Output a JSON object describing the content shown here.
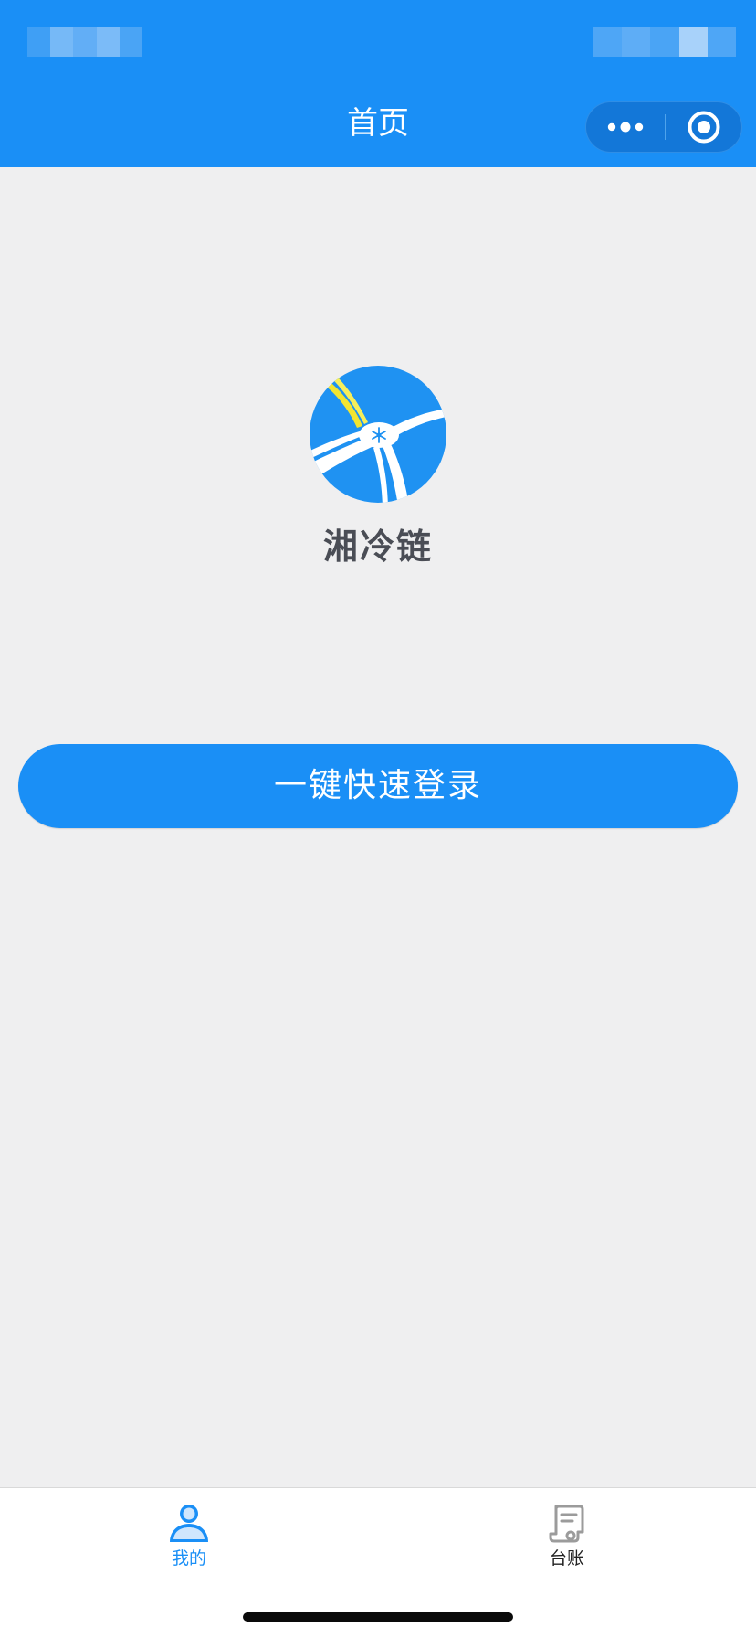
{
  "header": {
    "title": "首页",
    "background_color": "#1a8ff6",
    "capsule": {
      "more_icon": "more-dots-icon",
      "close_icon": "target-circle-icon"
    }
  },
  "brand": {
    "logo_icon": "snowflake-road-logo",
    "name": "湘冷链"
  },
  "login": {
    "button_label": "一键快速登录",
    "button_color": "#1a8ff6"
  },
  "tabbar": {
    "items": [
      {
        "label": "我的",
        "icon": "person-icon",
        "active": true,
        "color": "#1a8ff6"
      },
      {
        "label": "台账",
        "icon": "ledger-document-icon",
        "active": false,
        "color": "#222222"
      }
    ]
  }
}
